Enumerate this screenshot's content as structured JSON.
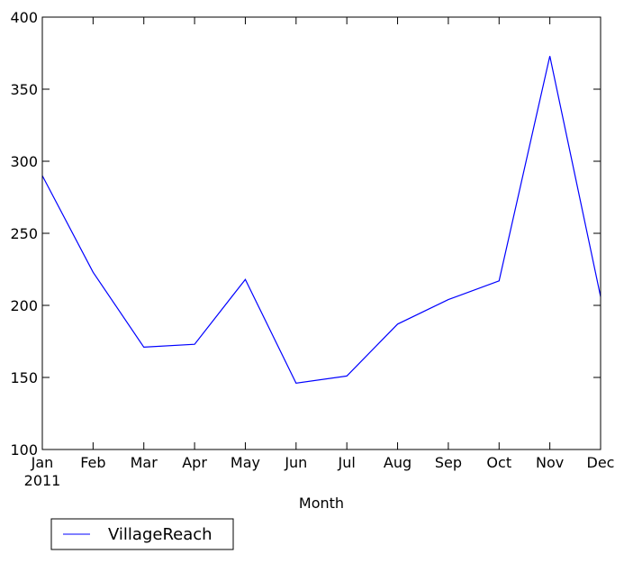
{
  "chart_data": {
    "type": "line",
    "title": "",
    "xlabel": "Month",
    "ylabel": "",
    "categories": [
      "Jan",
      "Feb",
      "Mar",
      "Apr",
      "May",
      "Jun",
      "Jul",
      "Aug",
      "Sep",
      "Oct",
      "Nov",
      "Dec"
    ],
    "x_year_label": "2011",
    "ylim": [
      100,
      400
    ],
    "yticks": [
      100,
      150,
      200,
      250,
      300,
      350,
      400
    ],
    "grid": false,
    "legend_placement": "below-left",
    "series": [
      {
        "name": "VillageReach",
        "color": "#0000ff",
        "values": [
          290,
          223,
          171,
          173,
          218,
          146,
          151,
          187,
          204,
          217,
          373,
          206
        ]
      }
    ]
  }
}
